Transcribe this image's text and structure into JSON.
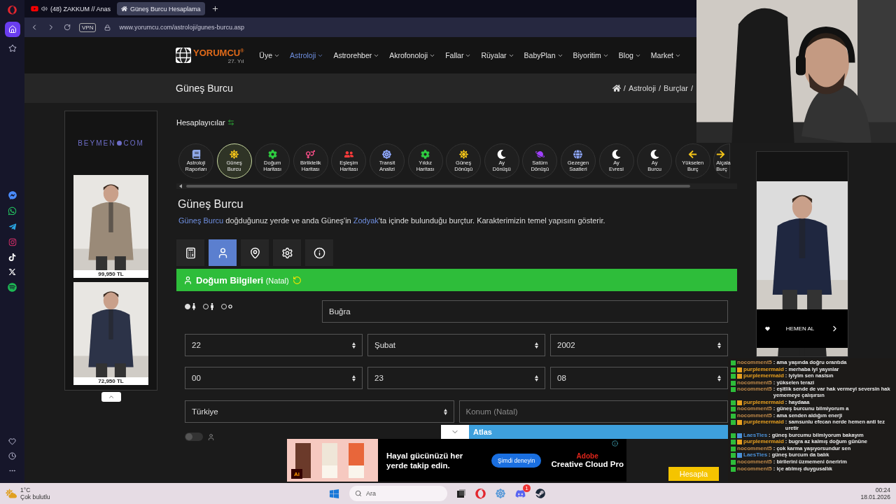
{
  "browser": {
    "tabs": [
      {
        "title": "(48) ZAKKUM // Anas",
        "selected": false,
        "audio": true
      },
      {
        "title": "Güneş Burcu Hesaplama",
        "selected": true,
        "audio": false
      }
    ],
    "vpn": "VPN",
    "address": "www.yorumcu.com/astroloji/gunes-burcu.asp"
  },
  "site": {
    "logo": "YORUMCU$^{®}$",
    "logo_sub": "27. Yıl",
    "nav": [
      {
        "label": "Üye",
        "selected": false
      },
      {
        "label": "Astroloji",
        "selected": true
      },
      {
        "label": "Astrorehber",
        "selected": false
      },
      {
        "label": "Akrofonoloji",
        "selected": false
      },
      {
        "label": "Fallar",
        "selected": false
      },
      {
        "label": "Rüyalar",
        "selected": false
      },
      {
        "label": "BabyPlan",
        "selected": false
      },
      {
        "label": "Biyoritim",
        "selected": false
      },
      {
        "label": "Blog",
        "selected": false
      },
      {
        "label": "Market",
        "selected": false
      }
    ],
    "page_title": "Güneş Burcu",
    "breadcrumb": {
      "separator": "/",
      "items": [
        "Astroloji",
        "Burçlar"
      ]
    }
  },
  "calculators": {
    "heading": "Hesaplayıcılar",
    "items": [
      {
        "lines": [
          "Astroloji",
          "Raporları"
        ],
        "kind": "book",
        "color": "#8fa8e8",
        "selected": false,
        "clipped": false
      },
      {
        "lines": [
          "Güneş",
          "Burcu"
        ],
        "kind": "sun",
        "color": "#f5c518",
        "selected": true,
        "clipped": false
      },
      {
        "lines": [
          "Doğum",
          "Haritası"
        ],
        "kind": "gear",
        "color": "#2ecc40",
        "selected": false,
        "clipped": false
      },
      {
        "lines": [
          "Birliktelik",
          "Haritası"
        ],
        "kind": "gender",
        "color": "#ff4f8b",
        "selected": false,
        "clipped": false
      },
      {
        "lines": [
          "Eşleşim",
          "Haritası"
        ],
        "kind": "people",
        "color": "#ff3b3b",
        "selected": false,
        "clipped": false
      },
      {
        "lines": [
          "Transit",
          "Analizi"
        ],
        "kind": "wheel",
        "color": "#8fa8ff",
        "selected": false,
        "clipped": false
      },
      {
        "lines": [
          "Yıldız",
          "Haritası"
        ],
        "kind": "gear",
        "color": "#2ecc40",
        "selected": false,
        "clipped": false
      },
      {
        "lines": [
          "Güneş",
          "Dönüşü"
        ],
        "kind": "sun",
        "color": "#f5c518",
        "selected": false,
        "clipped": false
      },
      {
        "lines": [
          "Ay",
          "Dönüşü"
        ],
        "kind": "moon",
        "color": "#ffffff",
        "selected": false,
        "clipped": false
      },
      {
        "lines": [
          "Satürn",
          "Dönüşü"
        ],
        "kind": "planet",
        "color": "#a040ff",
        "selected": false,
        "clipped": false
      },
      {
        "lines": [
          "Gezegen",
          "Saatleri"
        ],
        "kind": "globe",
        "color": "#8fa8ff",
        "selected": false,
        "clipped": false
      },
      {
        "lines": [
          "Ay",
          "Evresi"
        ],
        "kind": "moon",
        "color": "#ffffff",
        "selected": false,
        "clipped": false
      },
      {
        "lines": [
          "Ay",
          "Burcu"
        ],
        "kind": "moon",
        "color": "#ffffff",
        "selected": false,
        "clipped": false
      },
      {
        "lines": [
          "Yükselen",
          "Burç"
        ],
        "kind": "arrow-left",
        "color": "#f5c518",
        "selected": false,
        "clipped": false
      },
      {
        "lines": [
          "Alçala",
          "Burç"
        ],
        "kind": "arrow-right",
        "color": "#f5c518",
        "selected": false,
        "clipped": true
      }
    ]
  },
  "section": {
    "title": "Güneş Burcu",
    "intro": [
      {
        "text": "Güneş Burcu",
        "link": true
      },
      {
        "text": " doğduğunuz yerde ve anda Güneş'in ",
        "link": false
      },
      {
        "text": "Zodyak",
        "link": true
      },
      {
        "text": "'ta içinde bulunduğu burçtur. Karakterimizin temel yapısını gösterir.",
        "link": false
      }
    ]
  },
  "tool_tabs": [
    {
      "kind": "calculator",
      "selected": false
    },
    {
      "kind": "user",
      "selected": true
    },
    {
      "kind": "pin",
      "selected": false
    },
    {
      "kind": "gear",
      "selected": false
    },
    {
      "kind": "info",
      "selected": false
    }
  ],
  "form": {
    "title": "Doğum Bilgileri",
    "title_note": "(Natal)",
    "genders": [
      {
        "kind": "female",
        "selected": true
      },
      {
        "kind": "male",
        "selected": false
      },
      {
        "kind": "other",
        "selected": false
      }
    ],
    "name": "Buğra",
    "day": "22",
    "month": "Şubat",
    "year": "2002",
    "hour": "00",
    "minute": "23",
    "second": "08",
    "country": "Türkiye",
    "location_placeholder": "Konum (Natal)",
    "toggle_on": false,
    "submit": "Hesapla"
  },
  "atlas": {
    "label": "Atlas"
  },
  "left_ad": {
    "brand": "BEYMEN",
    "brand_end": "COM",
    "products": [
      {
        "price": "99,950 TL"
      },
      {
        "price": "72,950 TL"
      }
    ]
  },
  "right_ad": {
    "cta": "HEMEN AL"
  },
  "bottom_ad": {
    "badge": "Ai",
    "headline": "Hayal gücünüzü her yerde takip edin.",
    "button": "Şimdi deneyin",
    "brand": "Adobe",
    "product": "Creative Cloud Pro"
  },
  "chat": {
    "messages": [
      {
        "user": "nocomment5",
        "text": ": ama yaşında doğru orantıda",
        "color": "#c08a4a",
        "badge": false
      },
      {
        "user": "purplemermaid",
        "text": ": merhaba iyi yayınlar",
        "color": "#e8a020",
        "badge": true
      },
      {
        "user": "purplemermaid",
        "text": ": iyiyim sen naslsın",
        "color": "#e8a020",
        "badge": true
      },
      {
        "user": "nocomment5",
        "text": ": yükselen terazi",
        "color": "#c08a4a",
        "badge": false
      },
      {
        "user": "nocomment5",
        "text": ": eşitlik sende de var hak vermeyi seversin hak yememeye çalışırsın",
        "color": "#c08a4a",
        "badge": false
      },
      {
        "user": "purplemermaid",
        "text": ": haydaaa",
        "color": "#e8a020",
        "badge": true
      },
      {
        "user": "nocomment5",
        "text": ": güneş burcunu bilmiyorum a",
        "color": "#c08a4a",
        "badge": false
      },
      {
        "user": "nocomment5",
        "text": ": ama senden aldığım enerji",
        "color": "#c08a4a",
        "badge": false
      },
      {
        "user": "purplemermaid",
        "text": ": samsunlu efecan nerde hemen anti tez uretir",
        "color": "#e8a020",
        "badge": true
      },
      {
        "user": "LaesTies",
        "text": ": güneş burcumu bilmiyorum bakayım",
        "color": "#4a90d8",
        "badge": true
      },
      {
        "user": "purplemermaid",
        "text": ": bugra az kalmış doğum gününe",
        "color": "#e8a020",
        "badge": true
      },
      {
        "user": "nocomment5",
        "text": ": çok karma yaşıyorsundur sen",
        "color": "#c08a4a",
        "badge": false
      },
      {
        "user": "LaesTies",
        "text": ": güneş burcum da balık",
        "color": "#4a90d8",
        "badge": true
      },
      {
        "user": "nocomment5",
        "text": ": birilerini üzmemeni öneririm",
        "color": "#c08a4a",
        "badge": false
      },
      {
        "user": "nocomment5",
        "text": ": içe atılmış duygusallık",
        "color": "#c08a4a",
        "badge": false
      }
    ]
  },
  "taskbar": {
    "temperature": "1°C",
    "weather": "Çok bulutlu",
    "search_placeholder": "Ara",
    "notification_count": "1",
    "time": "00:24",
    "date": "18.01.2026"
  }
}
